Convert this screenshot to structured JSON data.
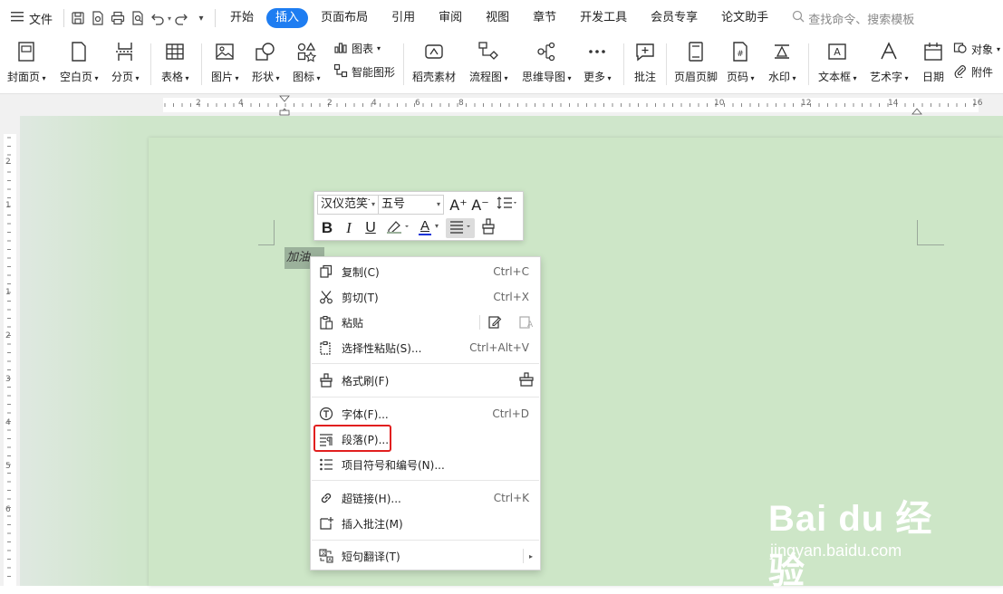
{
  "menubar": {
    "file_label": "文件",
    "tabs": [
      {
        "label": "开始"
      },
      {
        "label": "插入"
      },
      {
        "label": "页面布局"
      },
      {
        "label": "引用"
      },
      {
        "label": "审阅"
      },
      {
        "label": "视图"
      },
      {
        "label": "章节"
      },
      {
        "label": "开发工具"
      },
      {
        "label": "会员专享"
      },
      {
        "label": "论文助手"
      }
    ],
    "active_tab": "插入",
    "search_placeholder": "查找命令、搜索模板"
  },
  "ribbon": {
    "cover": "封面页",
    "blank": "空白页",
    "pagebreak": "分页",
    "table": "表格",
    "picture": "图片",
    "shape": "形状",
    "icon": "图标",
    "chart": "图表",
    "smartart": "智能图形",
    "material": "稻壳素材",
    "flowchart": "流程图",
    "mindmap": "思维导图",
    "more": "更多",
    "comment": "批注",
    "header_footer": "页眉页脚",
    "page_num": "页码",
    "watermark": "水印",
    "textbox": "文本框",
    "wordart": "艺术字",
    "date": "日期",
    "object": "对象",
    "attachment": "附件"
  },
  "ruler": {
    "h_numbers": [
      "2",
      "4",
      "2",
      "4",
      "6",
      "8",
      "10",
      "12",
      "14",
      "16"
    ],
    "v_numbers": [
      "2",
      "1",
      "1",
      "2",
      "3",
      "4",
      "5",
      "6"
    ]
  },
  "document": {
    "selected_text": "加油"
  },
  "minibar": {
    "font_name": "汉仪范笑言",
    "font_size": "五号",
    "grow": "A⁺",
    "shrink": "A⁻",
    "bold": "B",
    "italic": "I",
    "underline": "U",
    "font_color_letter": "A"
  },
  "context_menu": {
    "items": [
      {
        "label": "复制(C)",
        "shortcut": "Ctrl+C",
        "icon": "copy-icon"
      },
      {
        "label": "剪切(T)",
        "shortcut": "Ctrl+X",
        "icon": "cut-icon"
      },
      {
        "label": "粘贴",
        "shortcut": "",
        "icon": "paste-icon"
      },
      {
        "label": "选择性粘贴(S)...",
        "shortcut": "Ctrl+Alt+V",
        "icon": "paste-special-icon"
      },
      {
        "label": "格式刷(F)",
        "shortcut": "",
        "icon": "format-painter-icon"
      },
      {
        "label": "字体(F)...",
        "shortcut": "Ctrl+D",
        "icon": "font-icon"
      },
      {
        "label": "段落(P)...",
        "shortcut": "",
        "icon": "paragraph-icon"
      },
      {
        "label": "项目符号和编号(N)...",
        "shortcut": "",
        "icon": "bullets-icon"
      },
      {
        "label": "超链接(H)...",
        "shortcut": "Ctrl+K",
        "icon": "hyperlink-icon"
      },
      {
        "label": "插入批注(M)",
        "shortcut": "",
        "icon": "insert-comment-icon"
      },
      {
        "label": "短句翻译(T)",
        "shortcut": "",
        "icon": "translate-icon"
      }
    ],
    "highlighted": "段落(P)..."
  },
  "watermark": {
    "brand": "Bai du 经验",
    "url": "jingyan.baidu.com"
  },
  "colors": {
    "accent": "#1e7df1",
    "page_bg": "#cde6c7",
    "highlight_border": "#e11f1f"
  }
}
